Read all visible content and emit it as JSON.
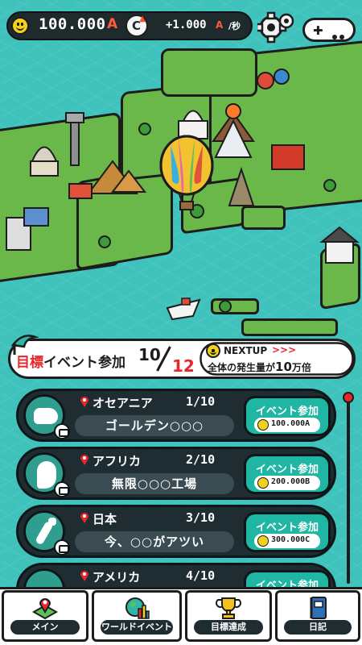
{
  "hud": {
    "balance": "100.000",
    "balance_unit": "A",
    "rate_icon_letter": "C",
    "rate": "+1.000",
    "rate_unit": "A",
    "rate_per": "/秒",
    "settings_icon": "gear-icon",
    "gamepad_icon": "gamepad-icon"
  },
  "goal": {
    "title_prefix": "目標",
    "title_suffix": "イベント参加",
    "current": "10",
    "total": "12",
    "next_label": "NEXTUP",
    "next_arrows": ">>>",
    "next_desc_a": "全体の発生量が",
    "next_desc_num": "10",
    "next_desc_b": "万倍"
  },
  "events": [
    {
      "region": "オセアニア",
      "progress": "1/10",
      "name": "ゴールデン○○○",
      "button": "イベント参加",
      "cost": "100.000A"
    },
    {
      "region": "アフリカ",
      "progress": "2/10",
      "name": "無限○○○工場",
      "button": "イベント参加",
      "cost": "200.000B"
    },
    {
      "region": "日本",
      "progress": "3/10",
      "name": "今、○○がアツい",
      "button": "イベント参加",
      "cost": "300.000C"
    },
    {
      "region": "アメリカ",
      "progress": "4/10",
      "name": "",
      "button": "イベント参加",
      "cost": ""
    }
  ],
  "nav": [
    {
      "label": "メイン",
      "icon": "map-pin-icon"
    },
    {
      "label": "ワールドイベント",
      "icon": "globe-chart-icon"
    },
    {
      "label": "目標達成",
      "icon": "trophy-icon"
    },
    {
      "label": "日記",
      "icon": "notebook-icon"
    }
  ],
  "colors": {
    "sea": "#3ec2bb",
    "land": "#6bb84a",
    "card_bg": "#1f2d33",
    "button_teal": "#20b6a4",
    "accent_red": "#e8262c",
    "coin_yellow": "#f3d21e"
  }
}
